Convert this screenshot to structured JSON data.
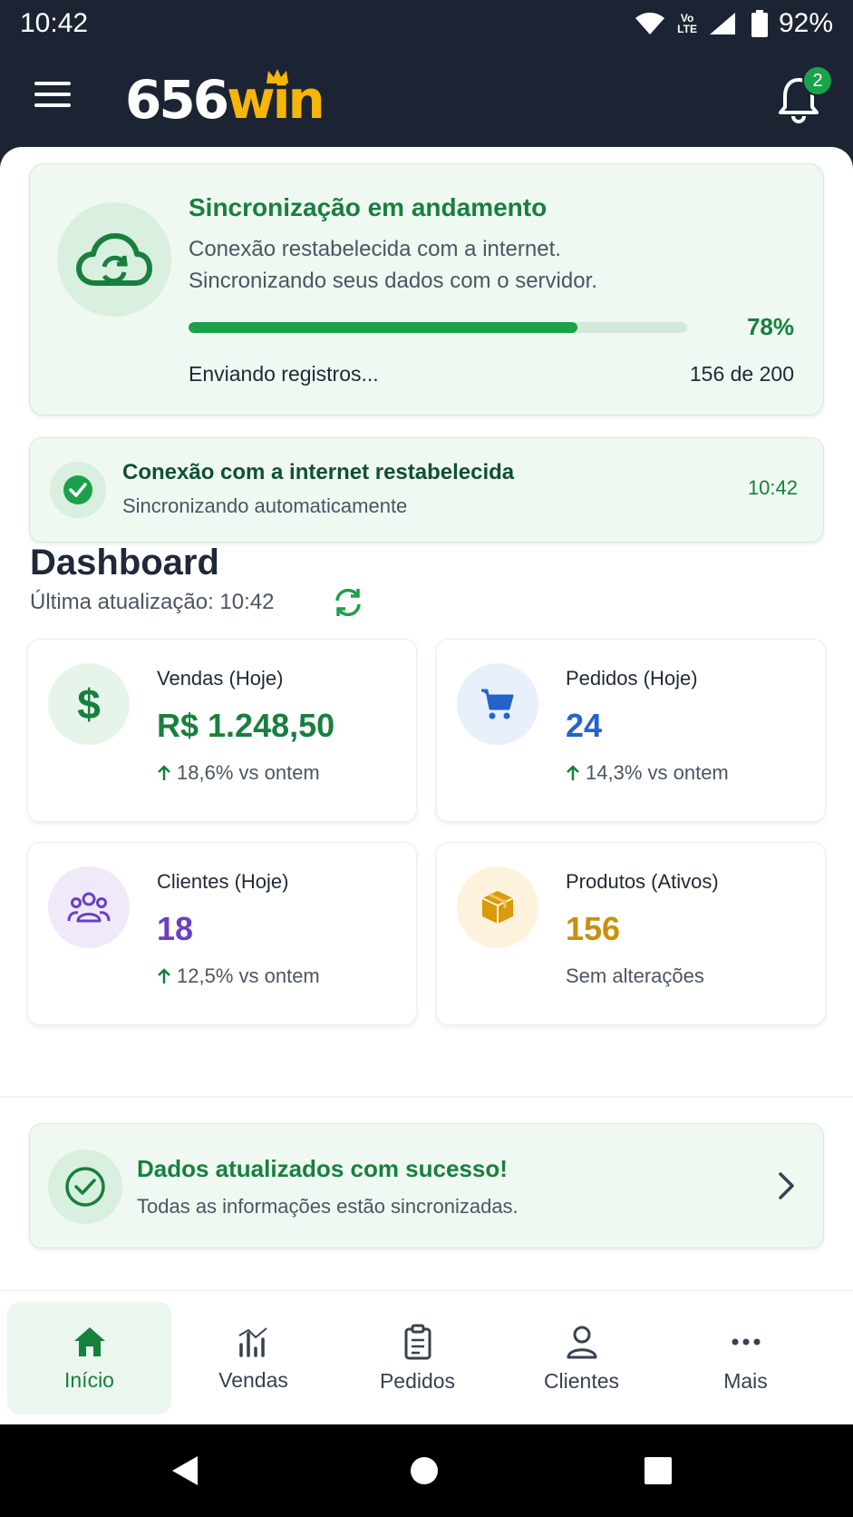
{
  "status_bar": {
    "time": "10:42",
    "network_label": "Vo\nLTE",
    "battery": "92%"
  },
  "header": {
    "logo_number": "656",
    "logo_word": "win",
    "notification_count": "2"
  },
  "sync_card": {
    "title": "Sincronização em andamento",
    "description": "Conexão restabelecida com a internet. Sincronizando seus dados com o servidor.",
    "progress": 0.78,
    "progress_label": "78%",
    "status": "Enviando registros...",
    "count": "156 de 200"
  },
  "connection_card": {
    "title": "Conexão com a internet restabelecida",
    "subtitle": "Sincronizando automaticamente",
    "time": "10:42"
  },
  "dashboard": {
    "title": "Dashboard",
    "updated": "Última atualização:  10:42",
    "stats": [
      {
        "label": "Vendas (Hoje)",
        "value": "R$ 1.248,50",
        "trend": "18,6% vs ontem",
        "color": "#17803d",
        "icon": "dollar-icon"
      },
      {
        "label": "Pedidos (Hoje)",
        "value": "24",
        "trend": "14,3% vs ontem",
        "color": "#2563c9",
        "icon": "cart-icon"
      },
      {
        "label": "Clientes (Hoje)",
        "value": "18",
        "trend": "12,5% vs ontem",
        "color": "#6b3fc4",
        "icon": "users-icon"
      },
      {
        "label": "Produtos (Ativos)",
        "value": "156",
        "trend": "Sem alterações",
        "color": "#c9900a",
        "icon": "box-icon"
      }
    ]
  },
  "success_card": {
    "title": "Dados atualizados com sucesso!",
    "subtitle": "Todas as informações estão sincronizadas."
  },
  "bottom_nav": [
    {
      "label": "Início",
      "icon": "home-icon",
      "active": true
    },
    {
      "label": "Vendas",
      "icon": "chart-icon",
      "active": false
    },
    {
      "label": "Pedidos",
      "icon": "clipboard-icon",
      "active": false
    },
    {
      "label": "Clientes",
      "icon": "user-icon",
      "active": false
    },
    {
      "label": "Mais",
      "icon": "more-icon",
      "active": false
    }
  ],
  "colors": {
    "header_bg": "#1c2433",
    "accent_green": "#17803d",
    "card_green_bg": "#eff8f1",
    "logo_yellow": "#f5b60a"
  }
}
